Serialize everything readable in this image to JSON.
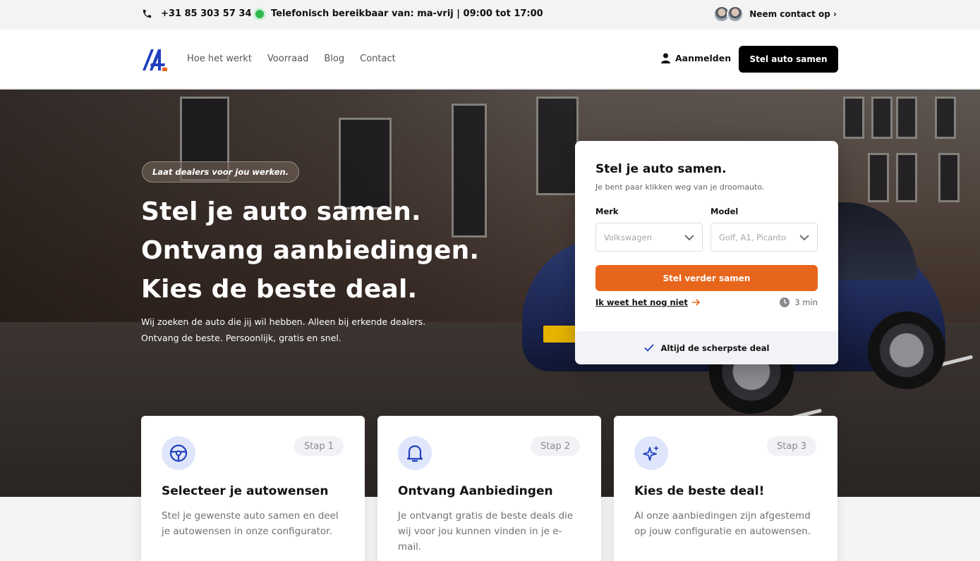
{
  "topbar": {
    "phone": "+31 85 303 57 34",
    "availability": "Telefonisch bereikbaar van: ma-vrij | 09:00 tot 17:00",
    "contact_label": "Neem contact op ›"
  },
  "nav": {
    "links": [
      "Hoe het werkt",
      "Voorraad",
      "Blog",
      "Contact"
    ],
    "login_label": "Aanmelden",
    "cta_label": "Stel auto samen"
  },
  "hero": {
    "badge": "Laat dealers voor jou werken.",
    "headline": [
      "Stel je auto samen.",
      "Ontvang aanbiedingen.",
      "Kies de beste deal."
    ],
    "subtext": [
      "Wij zoeken de auto die jij wil hebben. Alleen bij erkende dealers.",
      "Ontvang de beste. Persoonlijk, gratis en snel."
    ]
  },
  "configurator": {
    "title": "Stel je auto samen.",
    "description": "Je bent paar klikken weg van je droomauto.",
    "brand_label": "Merk",
    "brand_placeholder": "Volkswagen",
    "model_label": "Model",
    "model_placeholder": "Golf, A1, Picanto",
    "submit_label": "Stel verder samen",
    "unsure_link": "Ik weet het nog niet",
    "duration": "3 min",
    "footer": "Altijd de scherpste deal"
  },
  "steps": [
    {
      "badge": "Stap 1",
      "title": "Selecteer je autowensen",
      "text": "Stel je gewenste auto samen en deel je autowensen in onze configurator.",
      "icon": "steering-wheel-icon"
    },
    {
      "badge": "Stap 2",
      "title": "Ontvang Aanbiedingen",
      "text": "Je ontvangt gratis de beste deals die wij voor jou kunnen vinden in je e-mail.",
      "icon": "bell-icon"
    },
    {
      "badge": "Stap 3",
      "title": "Kies de beste deal!",
      "text": "Al onze aanbiedingen zijn afgestemd op jouw configuratie en autowensen.",
      "icon": "sparkles-icon"
    }
  ],
  "colors": {
    "accent": "#e8661c",
    "brand_blue": "#1f3fbf",
    "dark": "#000000"
  }
}
